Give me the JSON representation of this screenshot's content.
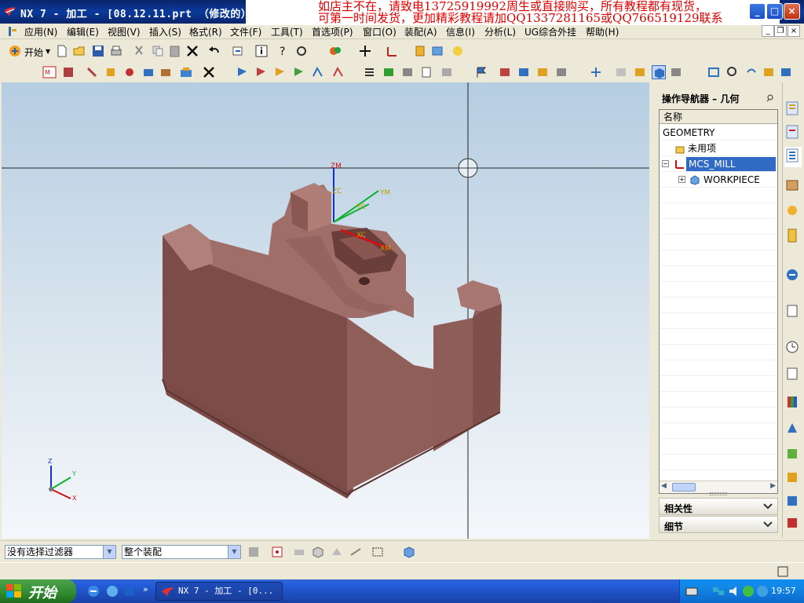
{
  "window": {
    "title": "NX 7 - 加工 - [08.12.11.prt （修改的）",
    "controls": {
      "minimize": "_",
      "maximize": "□",
      "close": "×"
    }
  },
  "ad_banner": {
    "line1": "如店主不在，请致电13725919992周生或直接购买，所有教程都有现货，",
    "line2": "可第一时间发货，更加精彩教程请加QQ1337281165或QQ766519129联系"
  },
  "menubar": {
    "items": [
      "应用(N)",
      "编辑(E)",
      "视图(V)",
      "插入(S)",
      "格式(R)",
      "文件(F)",
      "工具(T)",
      "首选项(P)",
      "窗口(O)",
      "装配(A)",
      "信息(I)",
      "分析(L)",
      "UG综合外挂",
      "帮助(H)"
    ]
  },
  "toolbar1": {
    "start_label": "开始"
  },
  "viewport": {
    "axis_labels": {
      "zm": "ZM",
      "zc": "ZC",
      "ym": "YM",
      "yc": "YC",
      "xc": "XC",
      "xm": "XM"
    },
    "triad": {
      "z": "Z",
      "y": "Y",
      "x": "X"
    }
  },
  "navigator": {
    "title": "操作导航器 – 几何",
    "column_header": "名称",
    "rows": [
      {
        "label": "GEOMETRY",
        "selected": false
      },
      {
        "label": "未用项",
        "selected": false
      },
      {
        "label": "MCS_MILL",
        "selected": true
      },
      {
        "label": "WORKPIECE",
        "selected": false
      }
    ],
    "sections": [
      {
        "label": "相关性"
      },
      {
        "label": "细节"
      }
    ]
  },
  "bottombar": {
    "filter_value": "没有选择过滤器",
    "scope_value": "整个装配"
  },
  "taskbar": {
    "start_label": "开始",
    "task_label": "NX 7 - 加工 - [0...",
    "clock": "19:57"
  },
  "colors": {
    "titlebar": "#0a246a",
    "part_fill": "#8e5a56",
    "selection": "#316ac5",
    "ad_text": "#e00000"
  }
}
